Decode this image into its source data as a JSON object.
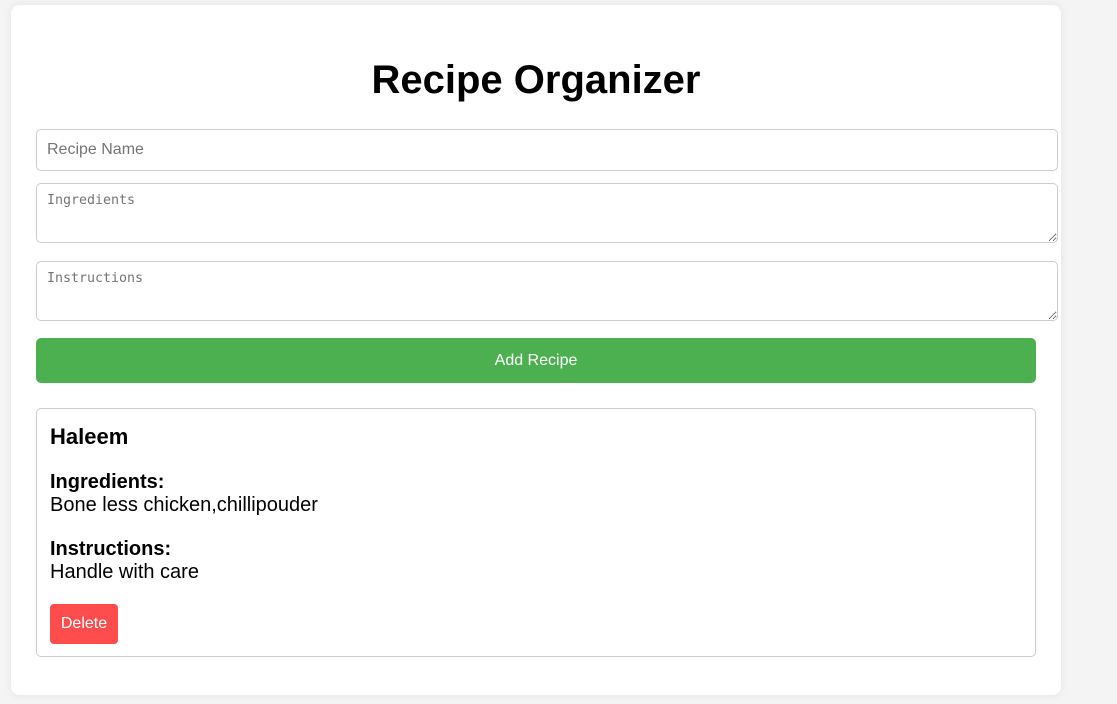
{
  "app": {
    "title": "Recipe Organizer"
  },
  "form": {
    "name_placeholder": "Recipe Name",
    "name_value": "",
    "ingredients_placeholder": "Ingredients",
    "ingredients_value": "",
    "instructions_placeholder": "Instructions",
    "instructions_value": "",
    "add_button_label": "Add Recipe"
  },
  "recipes": [
    {
      "name": "Haleem",
      "ingredients_label": "Ingredients:",
      "ingredients": "Bone less chicken,chillipouder",
      "instructions_label": "Instructions:",
      "instructions": "Handle with care",
      "delete_label": "Delete"
    }
  ],
  "colors": {
    "page_background": "#f4f4f4",
    "card_background": "#ffffff",
    "add_button": "#4caf50",
    "delete_button": "#ff4d4d",
    "border": "#cccccc"
  }
}
